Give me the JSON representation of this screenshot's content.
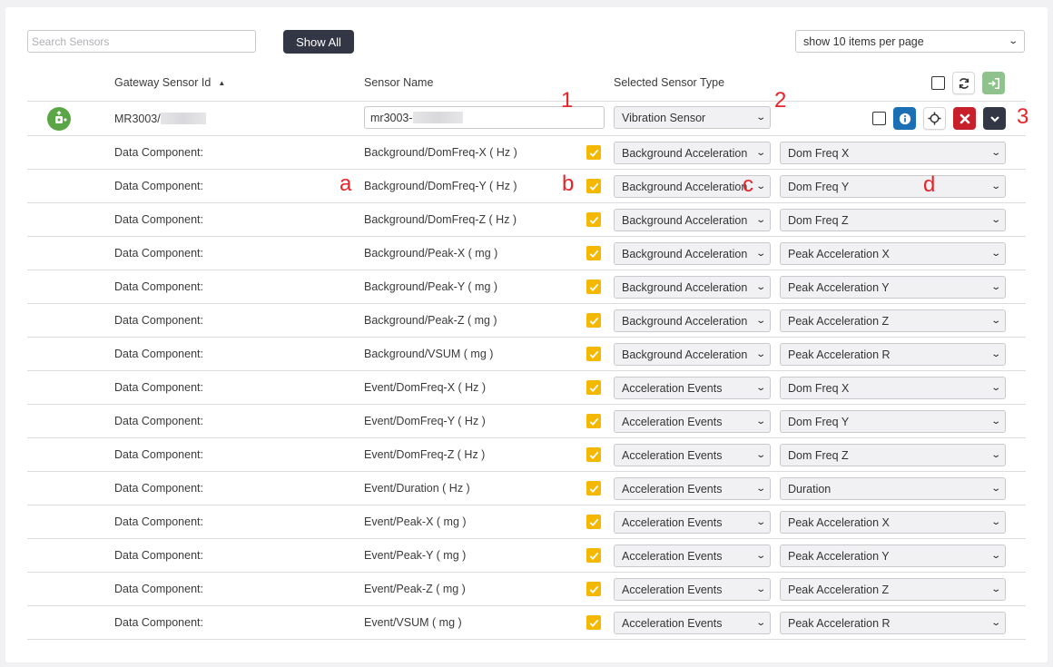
{
  "toolbar": {
    "search_placeholder": "Search Sensors",
    "show_all_label": "Show All",
    "per_page_value": "show 10 items per page"
  },
  "table": {
    "headers": {
      "gateway_id": "Gateway Sensor Id",
      "sensor_name": "Sensor Name",
      "sensor_type": "Selected Sensor Type"
    },
    "main_row": {
      "gateway_id": "MR3003/",
      "sensor_name": "mr3003-",
      "sensor_type": "Vibration Sensor"
    },
    "components": [
      {
        "label": "Data Component:",
        "name": "Background/DomFreq-X ( Hz )",
        "type": "Background Acceleration",
        "field": "Dom Freq X"
      },
      {
        "label": "Data Component:",
        "name": "Background/DomFreq-Y ( Hz )",
        "type": "Background Acceleration",
        "field": "Dom Freq Y"
      },
      {
        "label": "Data Component:",
        "name": "Background/DomFreq-Z ( Hz )",
        "type": "Background Acceleration",
        "field": "Dom Freq Z"
      },
      {
        "label": "Data Component:",
        "name": "Background/Peak-X ( mg )",
        "type": "Background Acceleration",
        "field": "Peak Acceleration X"
      },
      {
        "label": "Data Component:",
        "name": "Background/Peak-Y ( mg )",
        "type": "Background Acceleration",
        "field": "Peak Acceleration Y"
      },
      {
        "label": "Data Component:",
        "name": "Background/Peak-Z ( mg )",
        "type": "Background Acceleration",
        "field": "Peak Acceleration Z"
      },
      {
        "label": "Data Component:",
        "name": "Background/VSUM ( mg )",
        "type": "Background Acceleration",
        "field": "Peak Acceleration R"
      },
      {
        "label": "Data Component:",
        "name": "Event/DomFreq-X ( Hz )",
        "type": "Acceleration Events",
        "field": "Dom Freq X"
      },
      {
        "label": "Data Component:",
        "name": "Event/DomFreq-Y ( Hz )",
        "type": "Acceleration Events",
        "field": "Dom Freq Y"
      },
      {
        "label": "Data Component:",
        "name": "Event/DomFreq-Z ( Hz )",
        "type": "Acceleration Events",
        "field": "Dom Freq Z"
      },
      {
        "label": "Data Component:",
        "name": "Event/Duration ( Hz )",
        "type": "Acceleration Events",
        "field": "Duration"
      },
      {
        "label": "Data Component:",
        "name": "Event/Peak-X ( mg )",
        "type": "Acceleration Events",
        "field": "Peak Acceleration X"
      },
      {
        "label": "Data Component:",
        "name": "Event/Peak-Y ( mg )",
        "type": "Acceleration Events",
        "field": "Peak Acceleration Y"
      },
      {
        "label": "Data Component:",
        "name": "Event/Peak-Z ( mg )",
        "type": "Acceleration Events",
        "field": "Peak Acceleration Z"
      },
      {
        "label": "Data Component:",
        "name": "Event/VSUM ( mg )",
        "type": "Acceleration Events",
        "field": "Peak Acceleration R"
      }
    ]
  },
  "annotations": [
    "1",
    "2",
    "3",
    "a",
    "b",
    "c",
    "d"
  ],
  "colors": {
    "dark_button": "#333745",
    "checkbox_checked": "#f5b800",
    "info_button": "#1b6fb5",
    "delete_button": "#c8202a",
    "import_button": "#8fc28d",
    "sensor_avatar": "#5aa545",
    "annotation": "#e4262b"
  },
  "icons": {
    "sort": "sort-asc-icon",
    "refresh": "refresh-icon",
    "import": "sign-in-icon",
    "info": "info-icon",
    "locate": "crosshair-icon",
    "delete": "close-icon",
    "expand": "chevron-down-icon",
    "sensor": "sensor-device-icon"
  }
}
